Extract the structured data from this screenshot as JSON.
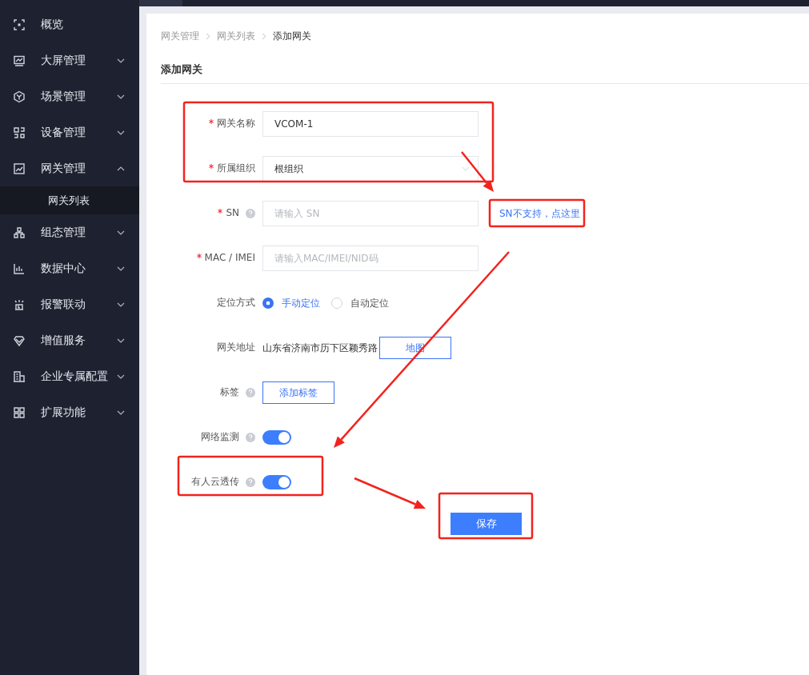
{
  "sidebar": {
    "items": [
      {
        "label": "概览",
        "kind": "link",
        "selected": false
      },
      {
        "label": "大屏管理",
        "kind": "group",
        "expanded": false,
        "selected": false
      },
      {
        "label": "场景管理",
        "kind": "group",
        "expanded": false,
        "selected": false
      },
      {
        "label": "设备管理",
        "kind": "group",
        "expanded": false,
        "selected": false
      },
      {
        "label": "网关管理",
        "kind": "group",
        "expanded": true,
        "selected": false,
        "children": [
          {
            "label": "网关列表",
            "selected": true
          }
        ]
      },
      {
        "label": "组态管理",
        "kind": "group",
        "expanded": false,
        "selected": false
      },
      {
        "label": "数据中心",
        "kind": "group",
        "expanded": false,
        "selected": false
      },
      {
        "label": "报警联动",
        "kind": "group",
        "expanded": false,
        "selected": false
      },
      {
        "label": "增值服务",
        "kind": "group",
        "expanded": false,
        "selected": false
      },
      {
        "label": "企业专属配置",
        "kind": "group",
        "expanded": false,
        "selected": false
      },
      {
        "label": "扩展功能",
        "kind": "group",
        "expanded": false,
        "selected": false
      }
    ]
  },
  "breadcrumb": [
    {
      "label": "网关管理",
      "current": false
    },
    {
      "label": "网关列表",
      "current": false
    },
    {
      "label": "添加网关",
      "current": true
    }
  ],
  "page_title": "添加网关",
  "form": {
    "fields": [
      {
        "kind": "text",
        "label": "网关名称",
        "required": true,
        "help": false,
        "value": "VCOM-1"
      },
      {
        "kind": "select",
        "label": "所属组织",
        "required": true,
        "help": false,
        "value": "根组织"
      },
      {
        "kind": "text",
        "label": "SN",
        "required": true,
        "help": true,
        "placeholder": "请输入 SN",
        "link": "SN不支持，点这里"
      },
      {
        "kind": "text",
        "label": "MAC / IMEI",
        "required": true,
        "help": false,
        "placeholder": "请输入MAC/IMEI/NID码"
      },
      {
        "kind": "radio",
        "label": "定位方式",
        "required": false,
        "help": false,
        "options": [
          {
            "label": "手动定位",
            "selected": true
          },
          {
            "label": "自动定位",
            "selected": false
          }
        ]
      },
      {
        "kind": "address",
        "label": "网关地址",
        "required": false,
        "help": false,
        "value": "山东省济南市历下区颖秀路",
        "button": "地图"
      },
      {
        "kind": "button",
        "label": "标签",
        "required": false,
        "help": true,
        "button": "添加标签"
      },
      {
        "kind": "switch",
        "label": "网络监测",
        "required": false,
        "help": true,
        "on": true
      },
      {
        "kind": "switch",
        "label": "有人云透传",
        "required": false,
        "help": true,
        "on": true
      }
    ],
    "submit": "保存"
  }
}
